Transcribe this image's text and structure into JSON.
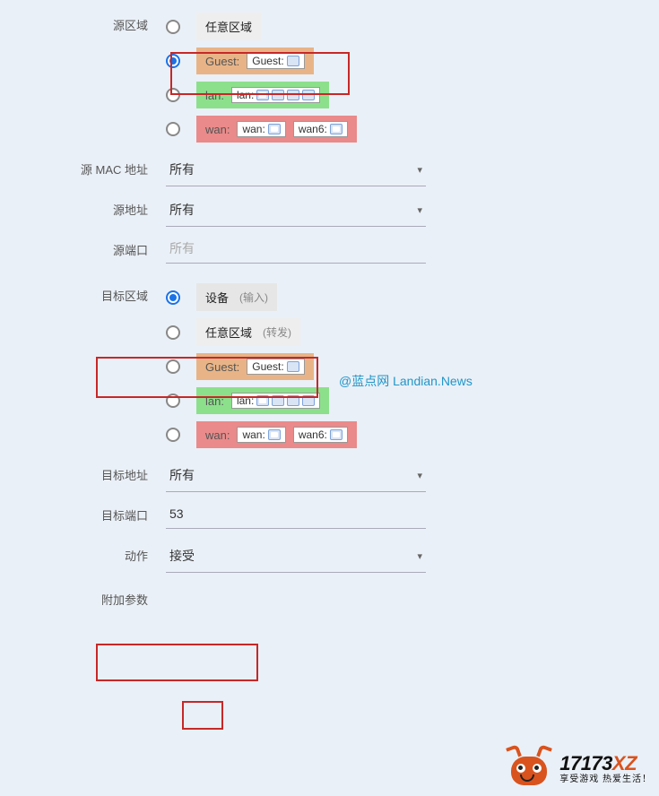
{
  "labels": {
    "src_zone": "源区域",
    "src_mac": "源 MAC 地址",
    "src_addr": "源地址",
    "src_port": "源端口",
    "dest_zone": "目标区域",
    "dest_addr": "目标地址",
    "dest_port": "目标端口",
    "action": "动作",
    "extra": "附加参数"
  },
  "src_zone": {
    "selected_index": 1,
    "options": [
      {
        "kind": "any",
        "text": "任意区域"
      },
      {
        "kind": "guest",
        "name": "Guest:",
        "ifaces": [
          "Guest:"
        ]
      },
      {
        "kind": "lan",
        "name": "lan:",
        "ifaces": [
          "lan:"
        ]
      },
      {
        "kind": "wan",
        "name": "wan:",
        "ifaces": [
          "wan:",
          "wan6:"
        ]
      }
    ]
  },
  "src_mac": {
    "value": "所有"
  },
  "src_addr": {
    "value": "所有"
  },
  "src_port": {
    "placeholder": "所有",
    "value": ""
  },
  "dest_zone": {
    "selected_index": 0,
    "options": [
      {
        "kind": "device",
        "text": "设备",
        "note": "(输入)"
      },
      {
        "kind": "any",
        "text": "任意区域",
        "note": "(转发)"
      },
      {
        "kind": "guest",
        "name": "Guest:",
        "ifaces": [
          "Guest:"
        ]
      },
      {
        "kind": "lan",
        "name": "lan:",
        "ifaces": [
          "lan:"
        ]
      },
      {
        "kind": "wan",
        "name": "wan:",
        "ifaces": [
          "wan:",
          "wan6:"
        ]
      }
    ]
  },
  "dest_addr": {
    "value": "所有"
  },
  "dest_port": {
    "value": "53"
  },
  "action": {
    "value": "接受"
  },
  "watermark": "@蓝点网 Landian.News",
  "logo": {
    "main_a": "17173",
    "main_b": "XZ",
    "sub": "享受游戏  热爱生活！"
  }
}
